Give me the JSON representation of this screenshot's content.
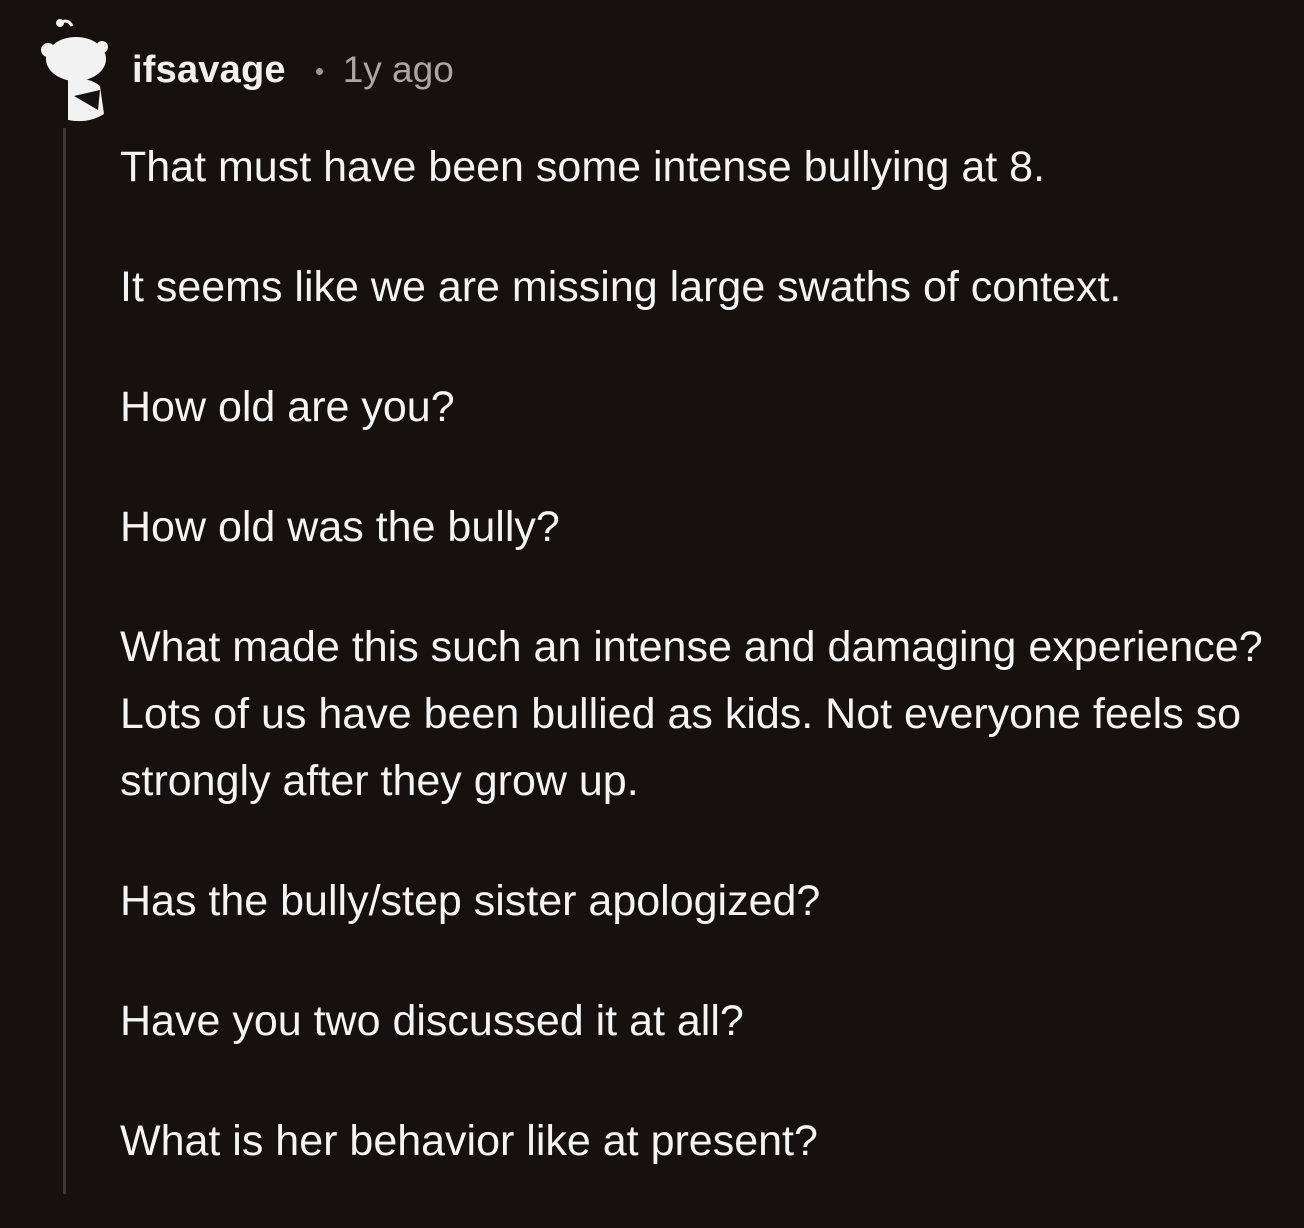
{
  "comment": {
    "username": "ifsavage",
    "timestamp": "1y ago",
    "paragraphs": [
      "That must have been some intense bullying at 8.",
      "It seems like we are missing large swaths of context.",
      "How old are you?",
      "How old was the bully?",
      "What made this such an intense and damaging experience? Lots of us have been bullied as kids. Not everyone feels so strongly after they grow up.",
      "Has the bully/step sister apologized?",
      "Have you two discussed it at all?",
      "What is her behavior like at present?"
    ]
  },
  "colors": {
    "background": "#14110f",
    "text": "#f4f4f4",
    "meta": "#a9a6a3",
    "thread_line": "#3a3838"
  },
  "icons": {
    "avatar": "snoo-avatar-icon"
  }
}
